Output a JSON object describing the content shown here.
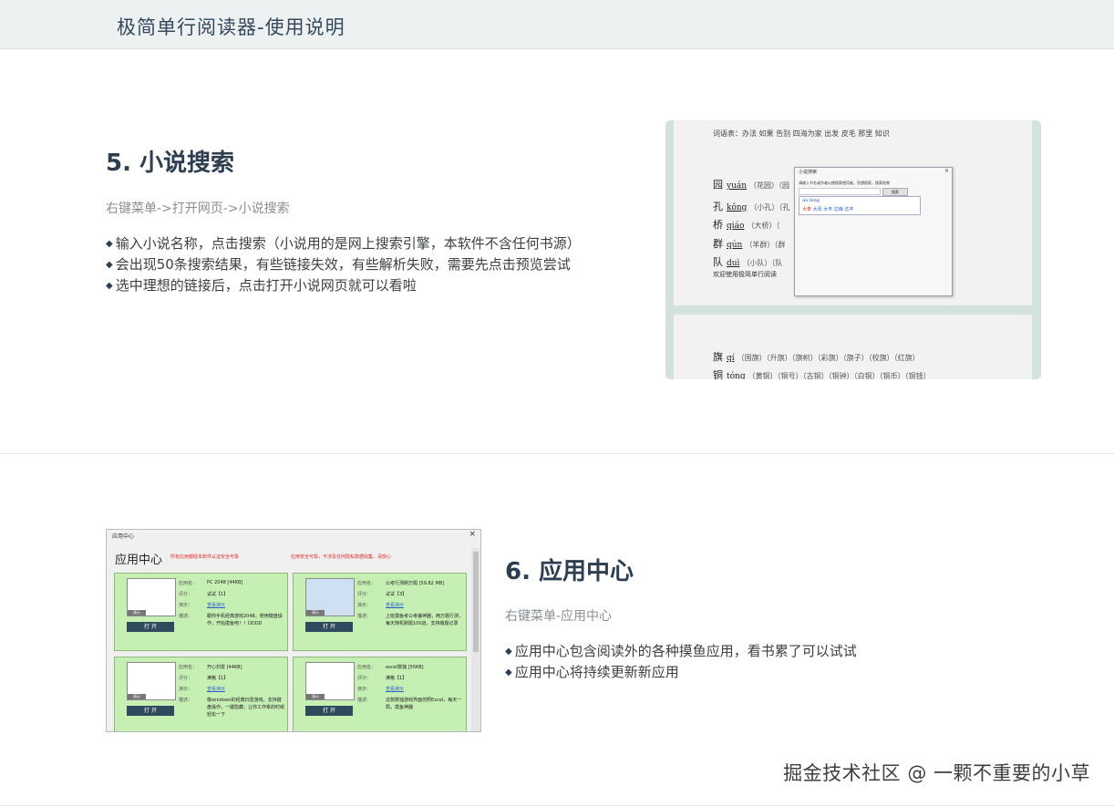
{
  "header": {
    "title": "极简单行阅读器-使用说明"
  },
  "section5": {
    "title": "5. 小说搜索",
    "subtitle": "右键菜单->打开网页->小说搜索",
    "bullets": [
      "输入小说名称，点击搜索（小说用的是网上搜索引擎，本软件不含任何书源）",
      "会出现50条搜索结果，有些链接失效，有些解析失败，需要先点击预览尝试",
      "选中理想的链接后，点击打开小说网页就可以看啦"
    ],
    "screenshot": {
      "wordlist": "词语表：办法 如果 告别 四海为家 出发 皮毛 那里 知识",
      "rows": [
        {
          "ch": "园",
          "py": "yuán",
          "words": "（花园）（园"
        },
        {
          "ch": "孔",
          "py": "kǒng",
          "words": "（小孔）（孔"
        },
        {
          "ch": "桥",
          "py": "qiáo",
          "words": "（大桥）（"
        },
        {
          "ch": "群",
          "py": "qún",
          "words": "（羊群）（群"
        },
        {
          "ch": "队",
          "py": "duì",
          "words": "（小队）（队"
        }
      ],
      "welcome": "欢迎使用极简单行阅读",
      "dialog": {
        "title": "小说搜索",
        "close": "×",
        "hint": "请输入书名或作者以便搜索使用者，您想搜索，搜索结果",
        "button": "搜索",
        "query": "da feng",
        "options": [
          "大奉",
          "大风",
          "大丰",
          "达峰",
          "达丰"
        ]
      },
      "rows2": [
        {
          "ch": "旗",
          "py": "qí",
          "words": "（国旗）（升旗）（旗帜）（彩旗）（旗子）（校旗）（红旗）"
        },
        {
          "ch": "铜",
          "py": "tóng",
          "words": "（黄铜）（铜号）（古铜）（铜钟）（白铜）（铜币）（铜钱）"
        }
      ]
    }
  },
  "section6": {
    "title": "6. 应用中心",
    "subtitle": "右键菜单-应用中心",
    "bullets": [
      "应用中心包含阅读外的各种摸鱼应用，看书累了可以试试",
      "应用中心将持续更新新应用"
    ],
    "screenshot": {
      "window_title": "应用中心",
      "close": "×",
      "heading": "应用中心",
      "notice1": "所有应用都经本软件认证安全可靠",
      "notice2": "应用安全可靠，不涉及任何隐私数据收集，请放心",
      "labels": {
        "name": "应用名：",
        "rating": "评分：",
        "demo": "演示：",
        "desc": "描述：",
        "demo_link": "查看演示",
        "open": "打 开",
        "tag": "演示"
      },
      "apps": [
        {
          "name": "PC 2048 [44KB]",
          "rating": "试试【1】",
          "desc": "跟你手机经典游戏2048，使用键盘操作，开始摸鱼吧！！DDDD"
        },
        {
          "name": "公考行测刷万题 [59.82 MB]",
          "rating": "试试【3】",
          "desc": "上班摸鱼考公考编神器，两万题行测，每天随机刷题100道，支持做题记录"
        },
        {
          "name": "开心扫雷 [44KB]",
          "rating": "满格【1】",
          "desc": "像windows的经典扫雷游戏，支持键盘操作，一键隐藏，让你工作累的时候轻松一下"
        },
        {
          "name": "excel数独 [55KB]",
          "rating": "满格【1】",
          "desc": "这款数独游戏界面仿照Excel，每天一局，摸鱼神器"
        }
      ]
    }
  },
  "watermark": "掘金技术社区 @ 一颗不重要的小草"
}
